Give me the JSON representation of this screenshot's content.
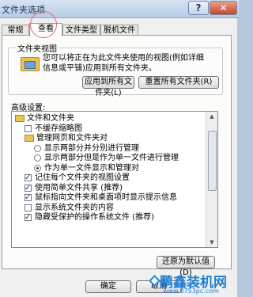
{
  "window": {
    "title": "文件夹选项",
    "help_label": "?",
    "close_label": "✕"
  },
  "tabs": [
    {
      "label": "常规",
      "active": false
    },
    {
      "label": "查看",
      "active": true
    },
    {
      "label": "文件类型",
      "active": false
    },
    {
      "label": "脱机文件",
      "active": false
    }
  ],
  "folder_views": {
    "legend": "文件夹视图",
    "description_line1": "您可以将正在为此文件夹使用的视图(例如详细",
    "description_line2": "信息或平铺)应用到所有文件夹。",
    "apply_label": "应用到所有文件夹(L)",
    "reset_label": "重置所有文件夹(R)"
  },
  "advanced": {
    "label": "高级设置:",
    "items": [
      {
        "type": "folder",
        "indent": 0,
        "label": "文件和文件夹"
      },
      {
        "type": "checkbox",
        "indent": 1,
        "checked": false,
        "label": "不缓存缩略图"
      },
      {
        "type": "folder",
        "indent": 1,
        "label": "管理网页和文件夹对"
      },
      {
        "type": "radio",
        "indent": 2,
        "checked": false,
        "label": "显示两部分并分别进行管理"
      },
      {
        "type": "radio",
        "indent": 2,
        "checked": false,
        "label": "显示两部分但是作为单一文件进行管理"
      },
      {
        "type": "radio",
        "indent": 2,
        "checked": true,
        "label": "作为单一文件显示和管理对"
      },
      {
        "type": "checkbox",
        "indent": 1,
        "checked": true,
        "label": "记住每个文件夹的视图设置"
      },
      {
        "type": "checkbox",
        "indent": 1,
        "checked": true,
        "label": "使用简单文件共享 (推荐)"
      },
      {
        "type": "checkbox",
        "indent": 1,
        "checked": true,
        "label": "鼠标指向文件夹和桌面项时显示提示信息"
      },
      {
        "type": "checkbox",
        "indent": 1,
        "checked": false,
        "label": "显示系统文件夹的内容"
      },
      {
        "type": "checkbox",
        "indent": 1,
        "checked": true,
        "label": "隐藏受保护的操作系统文件 (推荐)"
      }
    ],
    "restore_label": "还原为默认值(D)"
  },
  "footer": {
    "ok_label": "确定",
    "cancel_label": "取消"
  },
  "watermark": {
    "name": "鹏鑫装机网",
    "url": "www.0753pc.com"
  }
}
